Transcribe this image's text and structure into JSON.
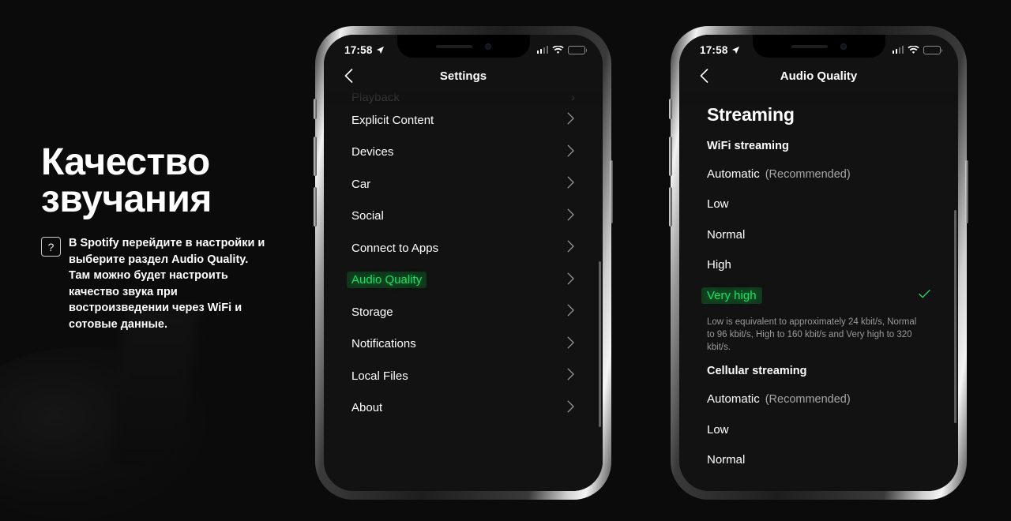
{
  "caption": {
    "title": "Качество\nзвучания",
    "help_icon": "?",
    "body": "В Spotify перейдите в настройки и выберите раздел Audio Quality. Там можно будет настроить качество звука при востроизведении через WiFi и сотовые данные."
  },
  "accent_green": "#1fdf64",
  "battery_color": "#f2d113",
  "phone_settings": {
    "status": {
      "time": "17:58",
      "location_icon": "location-arrow",
      "signal_icon": "cellular-bars",
      "wifi_icon": "wifi",
      "battery_icon": "battery-low-power"
    },
    "nav": {
      "back_icon": "chevron-left",
      "title": "Settings"
    },
    "cut_off_row": "Playback",
    "rows": [
      {
        "label": "Explicit Content",
        "highlighted": false
      },
      {
        "label": "Devices",
        "highlighted": false
      },
      {
        "label": "Car",
        "highlighted": false
      },
      {
        "label": "Social",
        "highlighted": false
      },
      {
        "label": "Connect to Apps",
        "highlighted": false
      },
      {
        "label": "Audio Quality",
        "highlighted": true
      },
      {
        "label": "Storage",
        "highlighted": false
      },
      {
        "label": "Notifications",
        "highlighted": false
      },
      {
        "label": "Local Files",
        "highlighted": false
      },
      {
        "label": "About",
        "highlighted": false
      }
    ]
  },
  "phone_audio": {
    "status": {
      "time": "17:58",
      "location_icon": "location-arrow",
      "signal_icon": "cellular-bars",
      "wifi_icon": "wifi",
      "battery_icon": "battery-low-power"
    },
    "nav": {
      "back_icon": "chevron-left",
      "title": "Audio Quality"
    },
    "heading": "Streaming",
    "wifi_section": {
      "title": "WiFi streaming",
      "options": [
        {
          "label": "Automatic",
          "note": "(Recommended)",
          "selected": false
        },
        {
          "label": "Low",
          "note": "",
          "selected": false
        },
        {
          "label": "Normal",
          "note": "",
          "selected": false
        },
        {
          "label": "High",
          "note": "",
          "selected": false
        },
        {
          "label": "Very high",
          "note": "",
          "selected": true
        }
      ],
      "footnote": "Low is equivalent to approximately 24 kbit/s, Normal to 96 kbit/s, High to 160 kbit/s and Very high to 320 kbit/s."
    },
    "cellular_section": {
      "title": "Cellular streaming",
      "options": [
        {
          "label": "Automatic",
          "note": "(Recommended)",
          "selected": false
        },
        {
          "label": "Low",
          "note": "",
          "selected": false
        },
        {
          "label": "Normal",
          "note": "",
          "selected": false
        }
      ]
    }
  }
}
